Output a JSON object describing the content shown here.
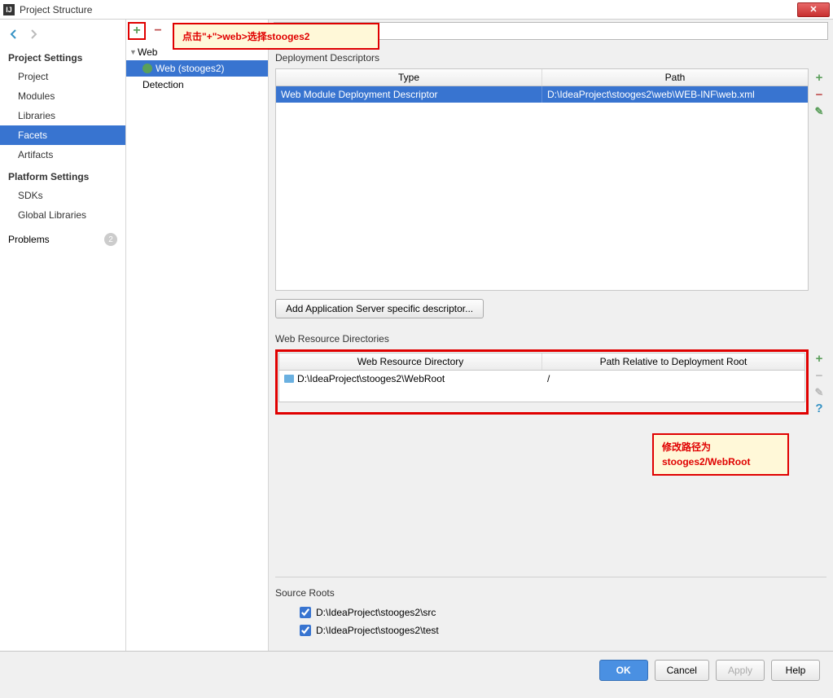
{
  "window": {
    "title": "Project Structure"
  },
  "sidebar": {
    "section1": "Project Settings",
    "items1": [
      "Project",
      "Modules",
      "Libraries",
      "Facets",
      "Artifacts"
    ],
    "section2": "Platform Settings",
    "items2": [
      "SDKs",
      "Global Libraries"
    ],
    "problems": "Problems",
    "problems_count": "2"
  },
  "tree": {
    "root": "Web",
    "child": "Web (stooges2)",
    "det": "Detection"
  },
  "annotations": {
    "a1": "点击\"+\">web>选择stooges2",
    "a2_line1": "修改路径为",
    "a2_line2": "stooges2/WebRoot"
  },
  "deploy": {
    "section": "Deployment Descriptors",
    "col1": "Type",
    "col2": "Path",
    "row_type": "Web Module Deployment Descriptor",
    "row_path": "D:\\IdeaProject\\stooges2\\web\\WEB-INF\\web.xml",
    "add_btn": "Add Application Server specific descriptor..."
  },
  "wrd": {
    "section": "Web Resource Directories",
    "col1": "Web Resource Directory",
    "col2": "Path Relative to Deployment Root",
    "row_dir": "D:\\IdeaProject\\stooges2\\WebRoot",
    "row_path": "/"
  },
  "source": {
    "section": "Source Roots",
    "r1": "D:\\IdeaProject\\stooges2\\src",
    "r2": "D:\\IdeaProject\\stooges2\\test"
  },
  "buttons": {
    "ok": "OK",
    "cancel": "Cancel",
    "apply": "Apply",
    "help": "Help"
  }
}
